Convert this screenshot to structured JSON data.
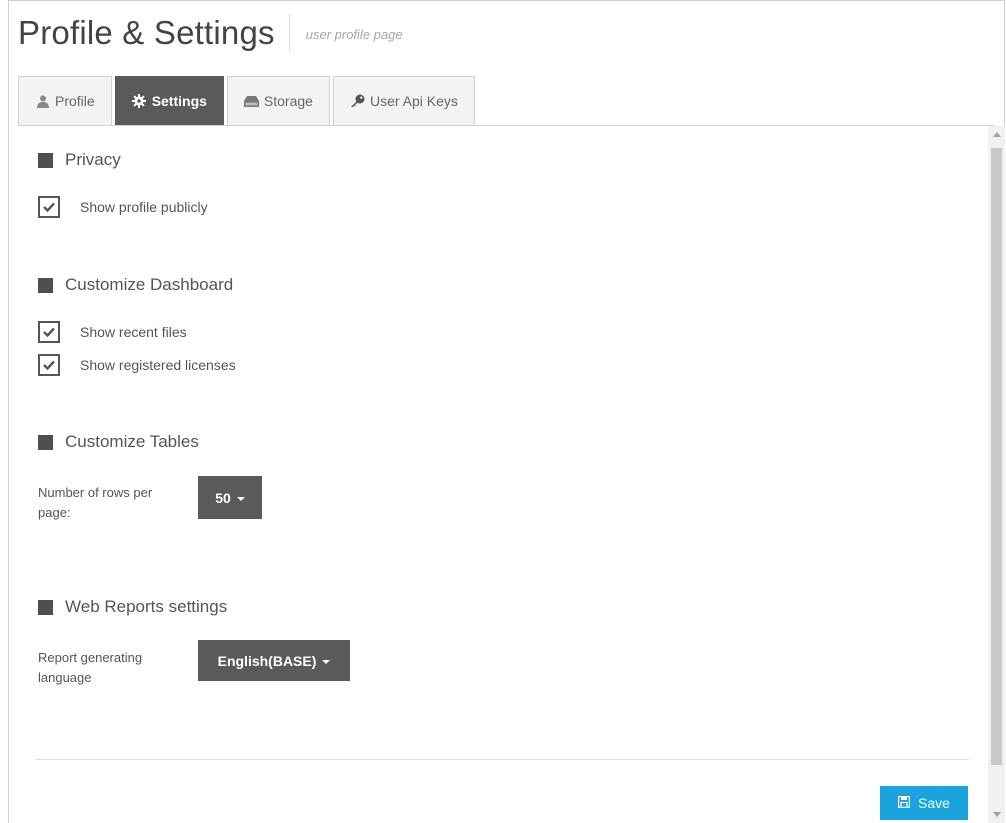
{
  "header": {
    "title": "Profile & Settings",
    "subtitle": "user profile page"
  },
  "tabs": [
    {
      "label": "Profile",
      "icon": "user-icon",
      "active": false
    },
    {
      "label": "Settings",
      "icon": "gear-icon",
      "active": true
    },
    {
      "label": "Storage",
      "icon": "hard-drive-icon",
      "active": false
    },
    {
      "label": "User Api Keys",
      "icon": "key-icon",
      "active": false
    }
  ],
  "sections": {
    "privacy": {
      "title": "Privacy",
      "options": [
        {
          "label": "Show profile publicly",
          "checked": true
        }
      ]
    },
    "dashboard": {
      "title": "Customize Dashboard",
      "options": [
        {
          "label": "Show recent files",
          "checked": true
        },
        {
          "label": "Show registered licenses",
          "checked": true
        }
      ]
    },
    "tables": {
      "title": "Customize Tables",
      "rows_label": "Number of rows per page:",
      "rows_value": "50"
    },
    "web_reports": {
      "title": "Web Reports settings",
      "language_label": "Report generating language",
      "language_value": "English(BASE)"
    }
  },
  "actions": {
    "save_label": "Save",
    "save_icon": "floppy-disk-icon"
  },
  "colors": {
    "active_tab": "#5a5a5a",
    "save_button": "#1aa3dc",
    "section_marker": "#4f4f4f"
  }
}
